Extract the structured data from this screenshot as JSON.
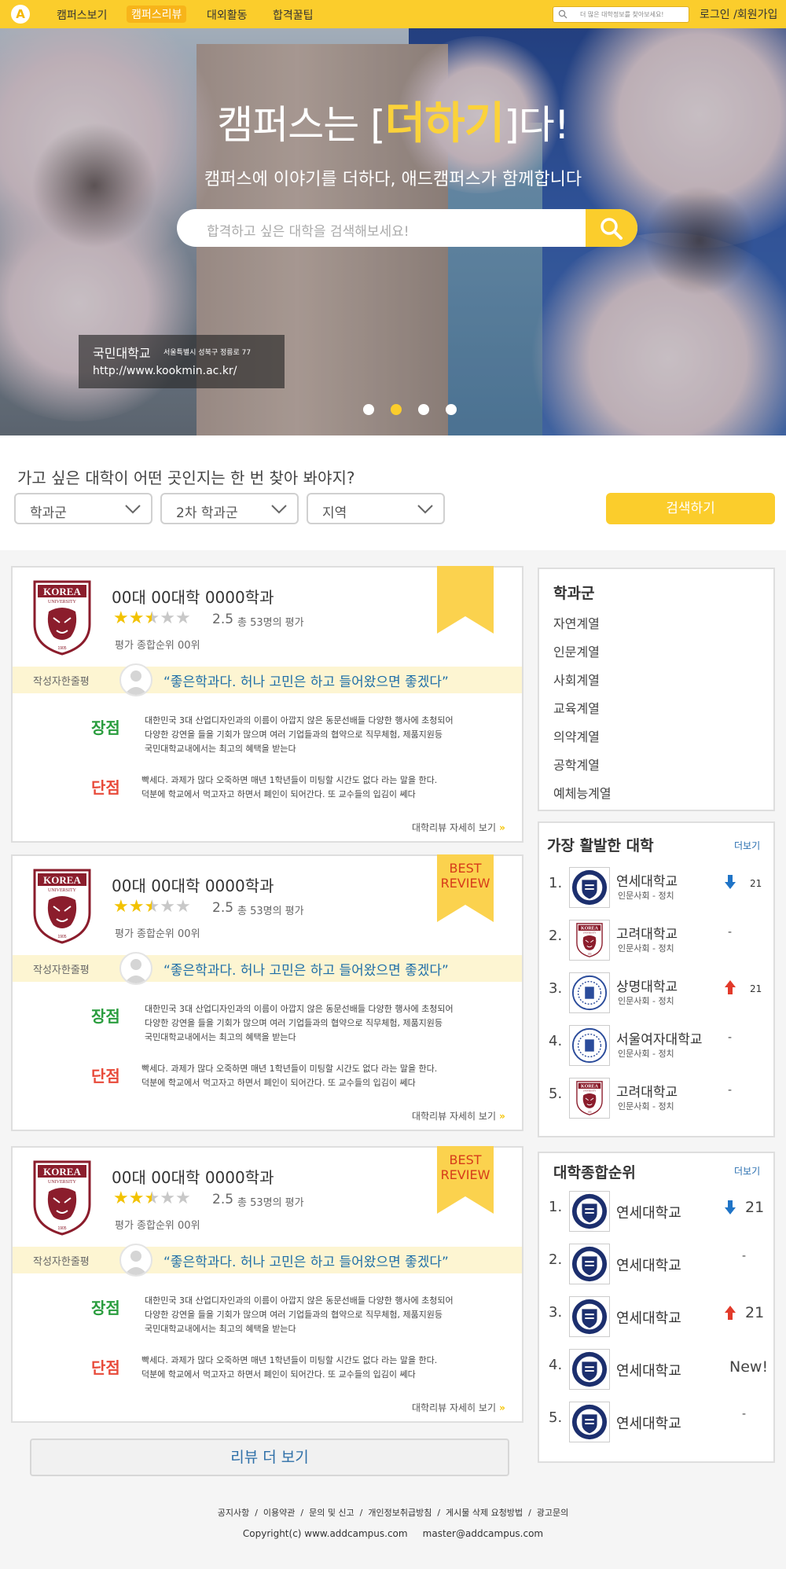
{
  "header": {
    "logo_letter": "A",
    "nav": [
      "캠퍼스보기",
      "캠퍼스리뷰",
      "대외활동",
      "합격꿀팁"
    ],
    "active_nav": "캠퍼스리뷰",
    "search_placeholder": "더 많은 대학정보를 찾아보세요!",
    "login_label": "로그인 /회원가입"
  },
  "hero": {
    "title_prefix": "캠퍼스는 [",
    "title_highlight": "더하기",
    "title_suffix": "]다!",
    "subtitle": "캠퍼스에 이야기를 더하다, 애드캠퍼스가 함께합니다",
    "search_placeholder": "합격하고 싶은 대학을 검색해보세요!",
    "caption": {
      "name": "국민대학교",
      "address": "서울특별시 성북구 정릉로 77",
      "url": "http://www.kookmin.ac.kr/"
    },
    "slides": 4,
    "active_slide": 2
  },
  "filter": {
    "question": "가고 싶은 대학이 어떤 곳인지는 한 번 찾아 봐야지?",
    "selects": [
      "학과군",
      "2차 학과군",
      "지역"
    ],
    "search_button": "검색하기"
  },
  "reviews": [
    {
      "logo_text": "KOREA",
      "logo_sub": "UNIVERSITY",
      "logo_year": "1905",
      "title": "00대 00대학 0000학과",
      "rating": 2.5,
      "score_text": "2.5",
      "count_text": "총 53명의 평가",
      "rank_text": "평가 종합순위 00위",
      "ribbon_text": "",
      "writer_label": "작성자한줄평",
      "quote": "“좋은학과다. 허나 고민은 하고 들어왔으면 좋겠다”",
      "pros_label": "장점",
      "pros": [
        "대한민국 3대 산업디자인과의 이름이 아깝지 않은 동문선배들 다양한 행사에 초청되어",
        "다양한 강연을 들을 기회가 많으며 여러 기업들과의 협약으로 직무체험, 제품지원등",
        "국민대학교내에서는 최고의 혜택을 받는다"
      ],
      "cons_label": "단점",
      "cons": [
        "빡세다. 과제가 많다 오죽하면 매년 1학년들이 미팅할 시간도 없다 라는 말을 한다.",
        "덕분에 학교에서 먹고자고 하면서 폐인이 되어간다. 또 교수들의 입김이 쎄다"
      ],
      "more": "대학리뷰 자세히 보기"
    },
    {
      "logo_text": "KOREA",
      "logo_sub": "UNIVERSITY",
      "logo_year": "1905",
      "title": "00대 00대학 0000학과",
      "rating": 2.5,
      "score_text": "2.5",
      "count_text": "총 53명의 평가",
      "rank_text": "평가 종합순위 00위",
      "ribbon_text": "BEST REVIEW",
      "writer_label": "작성자한줄평",
      "quote": "“좋은학과다. 허나 고민은 하고 들어왔으면 좋겠다”",
      "pros_label": "장점",
      "pros": [
        "대한민국 3대 산업디자인과의 이름이 아깝지 않은 동문선배들 다양한 행사에 초청되어",
        "다양한 강연을 들을 기회가 많으며 여러 기업들과의 협약으로 직무체험, 제품지원등",
        "국민대학교내에서는 최고의 혜택을 받는다"
      ],
      "cons_label": "단점",
      "cons": [
        "빡세다. 과제가 많다 오죽하면 매년 1학년들이 미팅할 시간도 없다 라는 말을 한다.",
        "덕분에 학교에서 먹고자고 하면서 폐인이 되어간다. 또 교수들의 입김이 쎄다"
      ],
      "more": "대학리뷰 자세히 보기"
    },
    {
      "logo_text": "KOREA",
      "logo_sub": "UNIVERSITY",
      "logo_year": "1905",
      "title": "00대 00대학 0000학과",
      "rating": 2.5,
      "score_text": "2.5",
      "count_text": "총 53명의 평가",
      "rank_text": "평가 종합순위 00위",
      "ribbon_text": "BEST REVIEW",
      "writer_label": "작성자한줄평",
      "quote": "“좋은학과다. 허나 고민은 하고 들어왔으면 좋겠다”",
      "pros_label": "장점",
      "pros": [
        "대한민국 3대 산업디자인과의 이름이 아깝지 않은 동문선배들 다양한 행사에 초청되어",
        "다양한 강연을 들을 기회가 많으며 여러 기업들과의 협약으로 직무체험, 제품지원등",
        "국민대학교내에서는 최고의 혜택을 받는다"
      ],
      "cons_label": "단점",
      "cons": [
        "빡세다. 과제가 많다 오죽하면 매년 1학년들이 미팅할 시간도 없다 라는 말을 한다.",
        "덕분에 학교에서 먹고자고 하면서 폐인이 되어간다. 또 교수들의 입김이 쎄다"
      ],
      "more": "대학리뷰 자세히 보기"
    }
  ],
  "more_reviews": "리뷰 더 보기",
  "categories": {
    "title": "학과군",
    "items": [
      "자연계열",
      "인문계열",
      "사회계열",
      "교육계열",
      "의약계열",
      "공학계열",
      "예체능계열"
    ]
  },
  "active_universities": {
    "title": "가장 활발한 대학",
    "more": "더보기",
    "items": [
      {
        "rank": "1.",
        "name": "연세대학교",
        "dept": "인문사회 - 정치",
        "trend": "down",
        "change": "21",
        "logo": "shield-emblem"
      },
      {
        "rank": "2.",
        "name": "고려대학교",
        "dept": "인문사회 - 정치",
        "trend": "same",
        "change": "-",
        "logo": "tiger-crest"
      },
      {
        "rank": "3.",
        "name": "상명대학교",
        "dept": "인문사회 - 정치",
        "trend": "up",
        "change": "21",
        "logo": "round-seal"
      },
      {
        "rank": "4.",
        "name": "서울여자대학교",
        "dept": "인문사회 - 정치",
        "trend": "same",
        "change": "-",
        "logo": "round-seal"
      },
      {
        "rank": "5.",
        "name": "고려대학교",
        "dept": "인문사회 - 정치",
        "trend": "same",
        "change": "-",
        "logo": "tiger-crest"
      }
    ]
  },
  "overall_ranking": {
    "title": "대학종합순위",
    "more": "더보기",
    "items": [
      {
        "rank": "1.",
        "name": "연세대학교",
        "trend": "down",
        "change": "21"
      },
      {
        "rank": "2.",
        "name": "연세대학교",
        "trend": "same",
        "change": "-"
      },
      {
        "rank": "3.",
        "name": "연세대학교",
        "trend": "up",
        "change": "21"
      },
      {
        "rank": "4.",
        "name": "연세대학교",
        "trend": "new",
        "change": "New!"
      },
      {
        "rank": "5.",
        "name": "연세대학교",
        "trend": "same",
        "change": "-"
      }
    ]
  },
  "footer": {
    "links": "공지사항  /  이용약관  /  문의 및 신고  /  개인정보취급방침  /  게시물 삭제 요청방법  /  광고문의",
    "copyright": "Copyright(c) www.addcampus.com     master@addcampus.com"
  },
  "colors": {
    "brand_yellow": "#fbcd2c",
    "link_blue": "#1e6ea8",
    "pros_green": "#2a9d3e",
    "cons_red": "#e84a3a",
    "trend_down": "#1f74c7",
    "trend_up": "#e23a2a"
  }
}
